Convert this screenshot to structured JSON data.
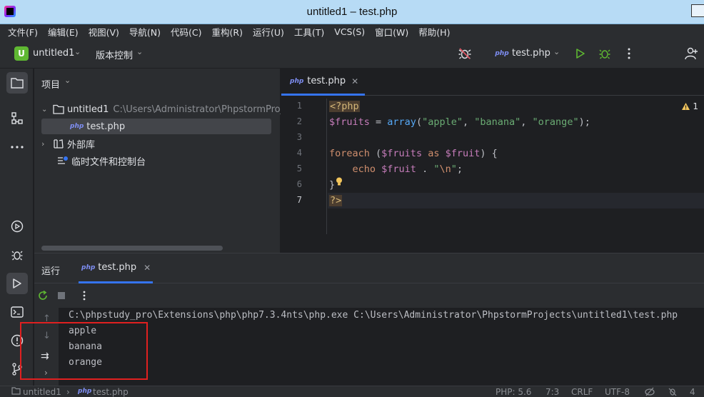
{
  "window": {
    "title": "untitled1 – test.php"
  },
  "menu": [
    "文件(F)",
    "编辑(E)",
    "视图(V)",
    "导航(N)",
    "代码(C)",
    "重构(R)",
    "运行(U)",
    "工具(T)",
    "VCS(S)",
    "窗口(W)",
    "帮助(H)"
  ],
  "toolbar": {
    "project_badge": "U",
    "project_name": "untitled1",
    "vcs_label": "版本控制",
    "run_config": "test.php",
    "php_label": "php"
  },
  "project_panel": {
    "title": "项目",
    "root_name": "untitled1",
    "root_path": "C:\\Users\\Administrator\\PhpstormProj",
    "file_name": "test.php",
    "external_libs": "外部库",
    "scratches": "临时文件和控制台"
  },
  "editor": {
    "tab_label": "test.php",
    "warning_count": "1",
    "line_numbers": [
      "1",
      "2",
      "3",
      "4",
      "5",
      "6",
      "7"
    ],
    "code": {
      "l1_tag": "<?php",
      "l2_var": "$fruits",
      "l2_eq": " = ",
      "l2_fn": "array",
      "l2_open": "(",
      "l2_s1": "\"apple\"",
      "l2_c1": ", ",
      "l2_s2": "\"banana\"",
      "l2_c2": ", ",
      "l2_s3": "\"orange\"",
      "l2_close": ");",
      "l4_kw": "foreach",
      "l4_open": " (",
      "l4_var1": "$fruits",
      "l4_as": " as ",
      "l4_var2": "$fruit",
      "l4_close": ") {",
      "l5_indent": "    ",
      "l5_kw": "echo",
      "l5_sp": " ",
      "l5_var": "$fruit",
      "l5_dot": " . ",
      "l5_q1": "\"",
      "l5_esc": "\\n",
      "l5_q2": "\"",
      "l5_end": ";",
      "l6": "}",
      "l7_tag": "?>"
    }
  },
  "run_panel": {
    "title": "运行",
    "tab_label": "test.php",
    "command": "C:\\phpstudy_pro\\Extensions\\php\\php7.3.4nts\\php.exe C:\\Users\\Administrator\\PhpstormProjects\\untitled1\\test.php",
    "output": [
      "apple",
      "banana",
      "orange"
    ]
  },
  "statusbar": {
    "breadcrumb_project": "untitled1",
    "breadcrumb_file": "test.php",
    "php_version": "PHP: 5.6",
    "position": "7:3",
    "line_ending": "CRLF",
    "encoding": "UTF-8",
    "indent": "4"
  },
  "colors": {
    "accent": "#3574f0",
    "highlight_box": "#e02020",
    "project_badge": "#5fb832"
  }
}
